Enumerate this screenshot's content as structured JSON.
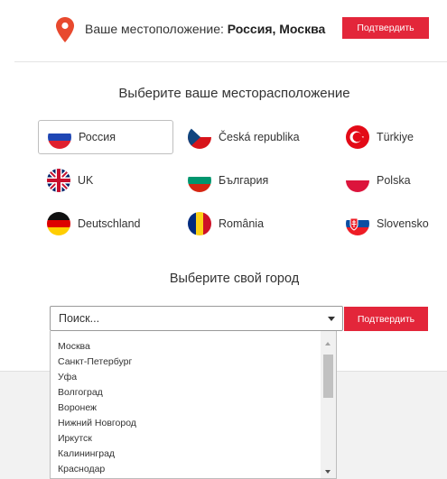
{
  "location_bar": {
    "label": "Ваше местоположение:",
    "current": "Россия, Москва",
    "confirm_label": "Подтвердить"
  },
  "country_section": {
    "heading": "Выберите ваше месторасположение",
    "selected": "Россия",
    "countries": [
      {
        "name": "Россия",
        "flag": "ru-flag"
      },
      {
        "name": "Česká republika",
        "flag": "cz-flag"
      },
      {
        "name": "Türkiye",
        "flag": "tr-flag"
      },
      {
        "name": "UK",
        "flag": "uk-flag"
      },
      {
        "name": "България",
        "flag": "bg-flag"
      },
      {
        "name": "Polska",
        "flag": "pl-flag"
      },
      {
        "name": "Deutschland",
        "flag": "de-flag"
      },
      {
        "name": "România",
        "flag": "ro-flag"
      },
      {
        "name": "Slovensko",
        "flag": "sk-flag"
      }
    ]
  },
  "city_section": {
    "heading": "Выберите свой город",
    "search_placeholder": "Поиск...",
    "confirm_label": "Подтвердить",
    "cities": [
      "Москва",
      "Санкт-Петербург",
      "Уфа",
      "Волгоград",
      "Воронеж",
      "Нижний Новгород",
      "Иркутск",
      "Калининград",
      "Краснодар"
    ]
  },
  "colors": {
    "accent": "#e3263a",
    "pin": "#e8492e"
  }
}
